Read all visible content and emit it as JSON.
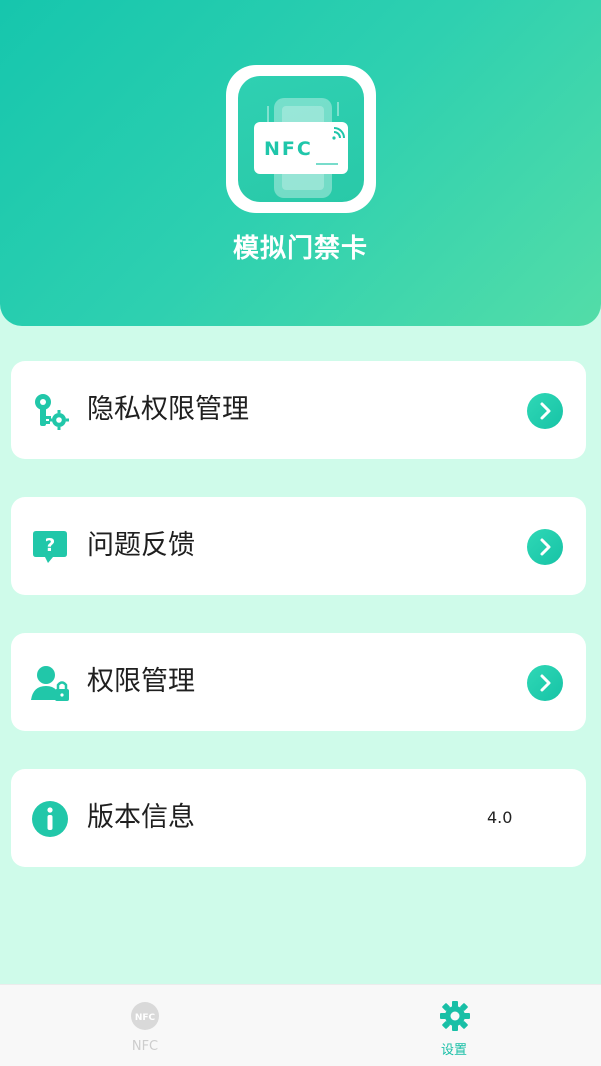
{
  "app": {
    "title": "模拟门禁卡",
    "icon_text": "NFC",
    "icon_name": "nfc-card-icon"
  },
  "settings": {
    "items": [
      {
        "label": "隐私权限管理",
        "icon": "key-gear-icon",
        "has_arrow": true
      },
      {
        "label": "问题反馈",
        "icon": "question-bubble-icon",
        "has_arrow": true
      },
      {
        "label": "权限管理",
        "icon": "user-lock-icon",
        "has_arrow": true
      },
      {
        "label": "版本信息",
        "icon": "info-icon",
        "value": "4.0",
        "has_arrow": false
      }
    ]
  },
  "tabbar": {
    "left_label": "NFC",
    "right_label": "设置",
    "left_icon": "nfc-tab-icon",
    "right_icon": "gear-icon",
    "active": "right"
  },
  "colors": {
    "accent": "#18bfa6",
    "background": "#cffbea",
    "header_start": "#16c6ad",
    "header_end": "#53dda8"
  }
}
